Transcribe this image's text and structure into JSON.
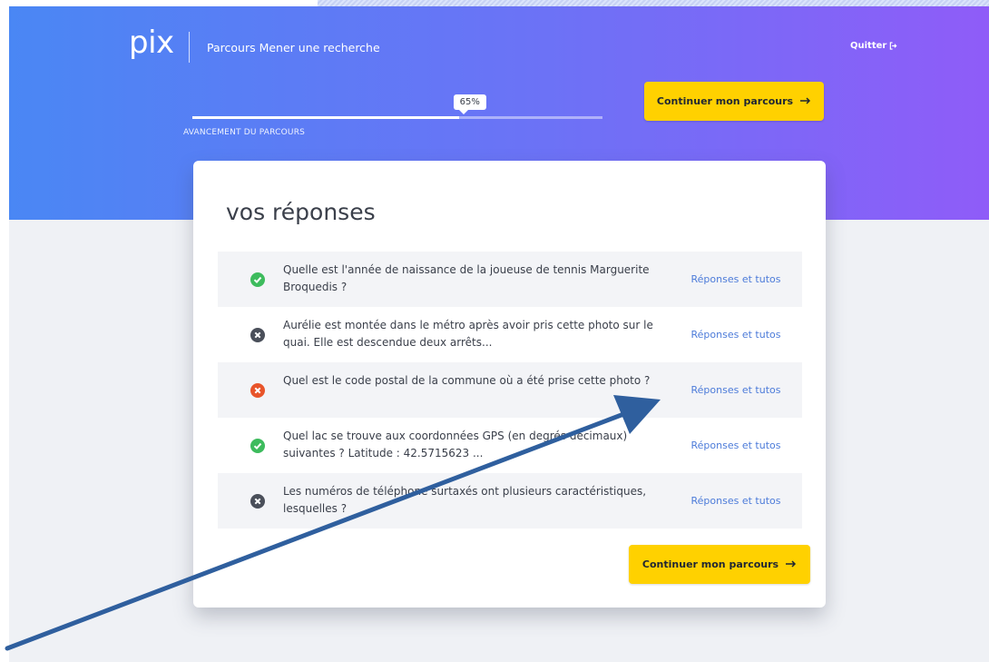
{
  "header": {
    "logo_text": "pix",
    "course_title": "Parcours Mener une recherche",
    "quit_label": "Quitter",
    "quit_icon": "logout-icon"
  },
  "progress": {
    "value_percent": 65,
    "label": "65%",
    "caption": "AVANCEMENT DU PARCOURS"
  },
  "continue_button": {
    "label": "Continuer mon parcours",
    "icon": "arrow-right-icon"
  },
  "results": {
    "title": "vos réponses",
    "link_label": "Réponses et tutos",
    "items": [
      {
        "status": "correct",
        "status_icon": "check-circle-icon",
        "question": "Quelle est l'année de naissance de la joueuse de tennis Marguerite Broquedis ?",
        "link": "Réponses et tutos"
      },
      {
        "status": "skipped",
        "status_icon": "x-circle-icon",
        "question": "Aurélie est montée dans le métro après avoir pris cette photo sur le quai. Elle est descendue deux arrêts...",
        "link": "Réponses et tutos"
      },
      {
        "status": "wrong",
        "status_icon": "x-circle-icon",
        "question": "Quel est le code postal de la commune où a été prise cette photo ?",
        "link": "Réponses et tutos"
      },
      {
        "status": "correct",
        "status_icon": "check-circle-icon",
        "question": "Quel lac se trouve aux coordonnées GPS (en degrés décimaux) suivantes ? Latitude : 42.5715623 ...",
        "link": "Réponses et tutos"
      },
      {
        "status": "skipped",
        "status_icon": "x-circle-icon",
        "question": "Les numéros de téléphone surtaxés ont plusieurs caractéristiques, lesquelles ?",
        "link": "Réponses et tutos"
      }
    ]
  },
  "colors": {
    "banner_start": "#4a87f4",
    "banner_end": "#8f5cf8",
    "button": "#ffd100",
    "link": "#4c7bd9",
    "correct": "#3dbb5d",
    "wrong": "#e8542a",
    "skipped": "#4a4f5a",
    "annotation_arrow": "#2f5f9e"
  }
}
